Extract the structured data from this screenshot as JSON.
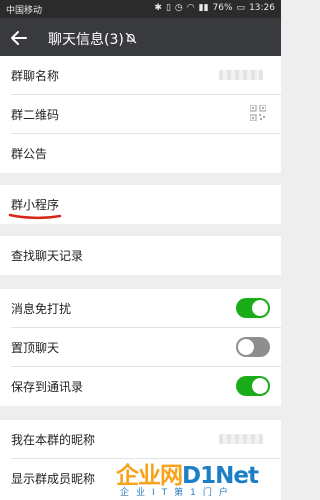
{
  "status_bar": {
    "carrier": "中国移动",
    "battery": "76%",
    "time": "13:26"
  },
  "title_bar": {
    "title": "聊天信息(3)",
    "back_icon": "arrow-left-icon",
    "mute_icon": "bell-muted-icon"
  },
  "group1": {
    "items": [
      {
        "label": "群聊名称"
      },
      {
        "label": "群二维码",
        "icon": "qr-code-icon"
      },
      {
        "label": "群公告"
      }
    ]
  },
  "group2": {
    "items": [
      {
        "label": "群小程序"
      }
    ]
  },
  "group3": {
    "items": [
      {
        "label": "查找聊天记录"
      }
    ]
  },
  "group4": {
    "items": [
      {
        "label": "消息免打扰",
        "enabled": true
      },
      {
        "label": "置顶聊天",
        "enabled": false
      },
      {
        "label": "保存到通讯录",
        "enabled": true
      }
    ]
  },
  "group5": {
    "items": [
      {
        "label": "我在本群的昵称"
      },
      {
        "label": "显示群成员昵称"
      }
    ]
  },
  "watermark": {
    "title_part1": "企业网",
    "title_part2": "D1Net",
    "subtitle": "企业IT第1门户"
  },
  "colors": {
    "title_bar": "#393a3e",
    "toggle_on": "#1aad19",
    "toggle_off": "#8e8e8e",
    "annotation": "#d9261c"
  }
}
